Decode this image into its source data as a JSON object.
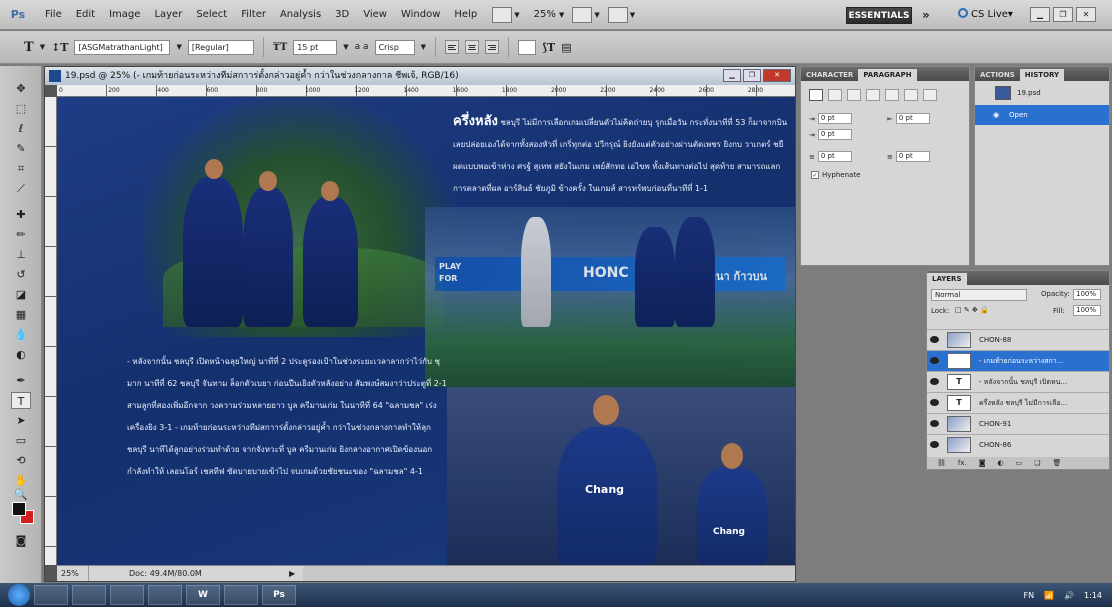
{
  "app": {
    "logo": "Ps",
    "menu": [
      "File",
      "Edit",
      "Image",
      "Layer",
      "Select",
      "Filter",
      "Analysis",
      "3D",
      "View",
      "Window",
      "Help"
    ],
    "zoom_select": "25%",
    "workspace": "ESSENTIALS",
    "overflow": "»",
    "cslive": "CS Live▾"
  },
  "options_bar": {
    "font_family": "[ASGMatrathanLight]",
    "font_style": "[Regular]",
    "font_size": "15 pt",
    "antialias_label": "a a",
    "antialias": "Crisp"
  },
  "document": {
    "title": "19.psd @ 25% (- เกมท้ายก่อนระหว่างทีม่สกาาร่ตั้งกล่าวอยู่ค้ำ กว่าในช่วงกลางกาล ชีพเจ้, RGB/16)",
    "ruler_labels": [
      "0",
      "200",
      "400",
      "600",
      "800",
      "1000",
      "1200",
      "1400",
      "1600",
      "1800",
      "2000",
      "2200",
      "2400",
      "2600",
      "2800",
      "3000"
    ],
    "status_zoom": "25%",
    "status_doc": "Doc: 49.4M/80.0M",
    "text_a_lead": "ครึ่งหลัง",
    "text_a": "ชลบุรี ไม่มีการเลือกเกมเปลี่ยนตัวไม่คิดถ่ายบุ รุกเมื่อวัน กระทั่งนาทีที่ 53 ก็มาจากบินเลยปล่อยเองได้จากทั้งสองหัวที่ เกริ่ทุกต่อ ปวีกรุณ์ ยิงยังแต่ตัวอย่างผ่านตัดเพชร ยิงกบ วาเกตร์ ชยืผดแบบพอเข้าห่าง ศรฐ้ สุเทพ สยังในเกม เพย์สักทอ เอไขพ ทั้งเส้นทางต่อไป สุดท้าย สามารถแลกการตลาดที่ผล อาร์สินธ์ ชัยภูมิ ข้างครั้ง ในเกมส์ สารทร์พบก่อนที่นาทีที่ 1-1",
    "text_b": "- หลังจากนั้น ชลบุรี เปิดหน้าฉลุยใหญ่ นาทีที่ 2 ประตูรองเป้าในช่วงระยะเวลาลากว่าไว่กับ ชุมาก นาทีที่ 62 ชลบุรี จันทาม ล็อกตัวเบยา ก่อนปืนเยิงตัวหลังอย่าง สัมพงษ์สมงาว่าประตูที่ 2-1 สามลูกที่สองเพิ่มอีกจาก วงความร่วมหลายยาว บูล ครีมานเก่ม ในนาทีที่ 64 \"ฉลามชล\" เร่งเครื่องยิง 3-1 - เกมท้ายก่อนระหว่างทีม่สกาาร่ตั้งกล่าวอยู่ค้ำ กว่าในช่วงกลางกาลทำให้ลุก ชลบุรี นาทีได้ลูกอย่างร่วมทำด้วย จากจังหวะที่ บูล ครีมานเก่ม ยิงกลางอากาศเปิดข้องนอกกำลังทำให้ เลอนโอร์ เชสทีฟ ซัดบายบายเข้าไป จบเกมด้วยชัยชนะของ \"ฉลามชล\" 4-1",
    "banner_left": "PLAY FOR",
    "banner_mid": "HONC",
    "banner_right": "เมนา ก้าวบน",
    "shirt_sponsor": "Chang"
  },
  "panels": {
    "char_tab": "CHARACTER",
    "para_tab": "PARAGRAPH",
    "indent_left": "0 pt",
    "indent_right": "0 pt",
    "indent_first": "0 pt",
    "space_before": "0 pt",
    "space_after": "0 pt",
    "hyphenate": "Hyphenate",
    "actions_tab": "ACTIONS",
    "history_tab": "HISTORY",
    "history_file": "19.psd",
    "history_item": "Open",
    "layers_tab": "LAYERS",
    "blend_mode": "Normal",
    "opacity_label": "Opacity:",
    "opacity": "100%",
    "lock_label": "Lock:",
    "fill_label": "Fill:",
    "fill": "100%",
    "layers": [
      {
        "name": "CHON-88",
        "type": "image",
        "selected": false
      },
      {
        "name": "- เกมท้ายก่อนระหว่างสกา...",
        "type": "text",
        "selected": true
      },
      {
        "name": "- หลังจากนั้น ชลบุรี เปิดหน...",
        "type": "text",
        "selected": false
      },
      {
        "name": "ครึ่งหลัง ชลบุรี ไม่มีการเลือ...",
        "type": "text",
        "selected": false
      },
      {
        "name": "CHON-91",
        "type": "image",
        "selected": false
      },
      {
        "name": "CHON-86",
        "type": "image",
        "selected": false
      }
    ],
    "text_layer_thumb": "T"
  },
  "taskbar": {
    "apps": [
      "",
      "",
      "",
      "",
      "W",
      "",
      "Ps"
    ],
    "lang": "FN",
    "time": "1:14"
  },
  "colors": {
    "canvas_blue": "#1f3d86",
    "selection_blue": "#2a70d0",
    "foreground": "#111111",
    "background": "#d21f1f"
  }
}
